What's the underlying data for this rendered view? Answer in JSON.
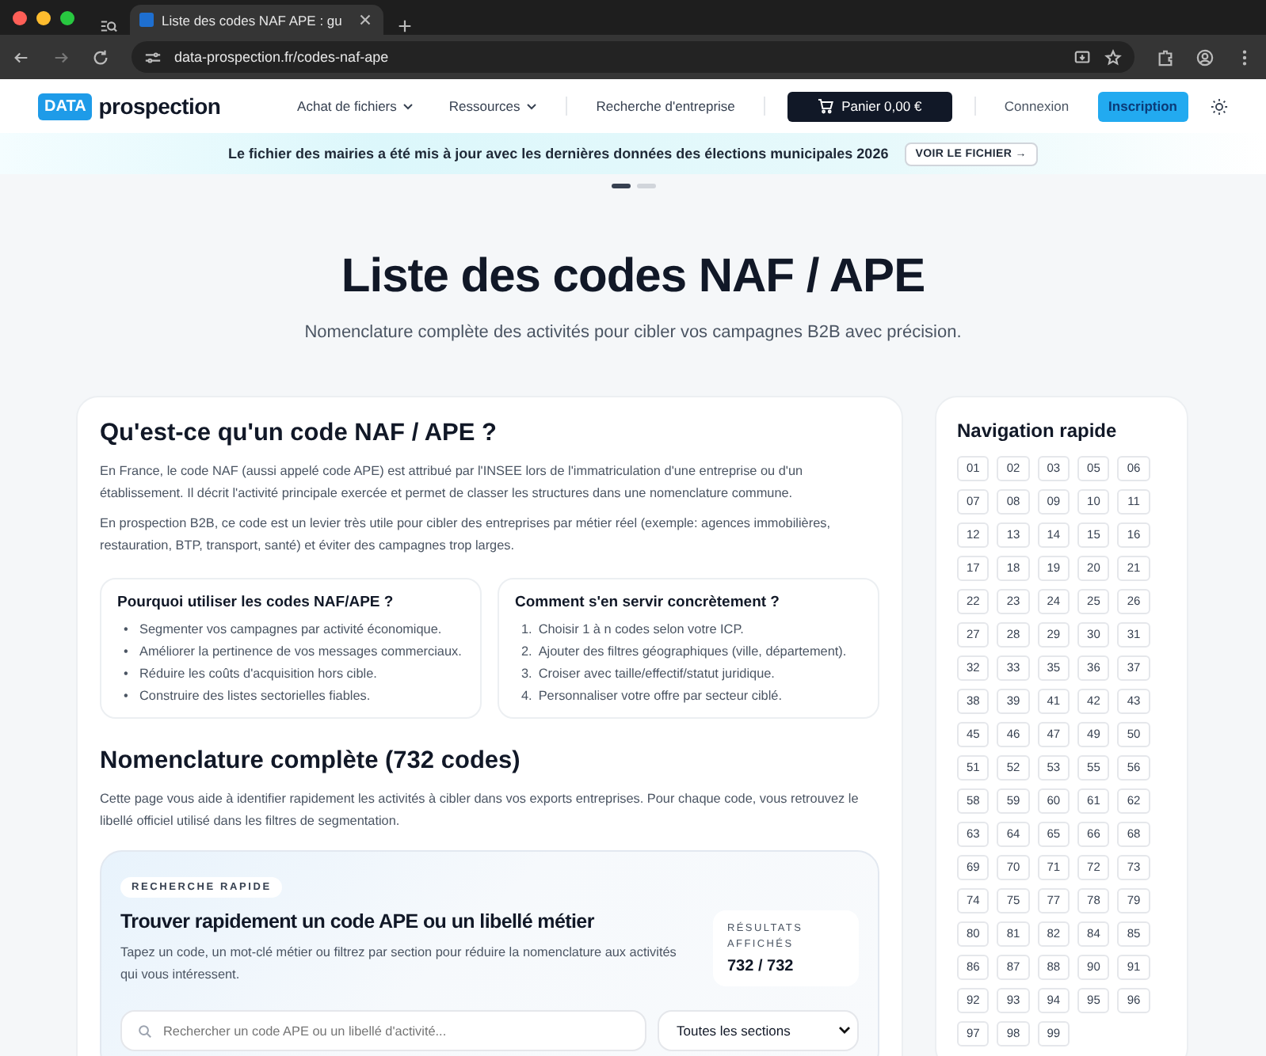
{
  "browser": {
    "tab_title": "Liste des codes NAF APE : gu",
    "url": "data-prospection.fr/codes-naf-ape"
  },
  "header": {
    "logo_badge": "DATA",
    "logo_text": "prospection",
    "nav": [
      {
        "label": "Achat de fichiers",
        "dropdown": true
      },
      {
        "label": "Ressources",
        "dropdown": true
      },
      {
        "label": "Recherche d'entreprise",
        "dropdown": false
      }
    ],
    "cart": "Panier 0,00 €",
    "login": "Connexion",
    "signup": "Inscription"
  },
  "banner": {
    "text": "Le fichier des mairies a été mis à jour avec les dernières données des élections municipales 2026",
    "button": "VOIR LE FICHIER →"
  },
  "carousel_dots": [
    {
      "selected": true
    },
    {
      "selected": false
    }
  ],
  "hero": {
    "title": "Liste des codes NAF / APE",
    "subtitle": "Nomenclature complète des activités pour cibler vos campagnes B2B avec précision."
  },
  "intro": {
    "title": "Qu'est-ce qu'un code NAF / APE ?",
    "paragraphs": [
      "En France, le code NAF (aussi appelé code APE) est attribué par l'INSEE lors de l'immatriculation d'une entreprise ou d'un établissement. Il décrit l'activité principale exercée et permet de classer les structures dans une nomenclature commune.",
      "En prospection B2B, ce code est un levier très utile pour cibler des entreprises par métier réel (exemple: agences immobilières, restauration, BTP, transport, santé) et éviter des campagnes trop larges."
    ],
    "boxes": [
      {
        "title": "Pourquoi utiliser les codes NAF/APE ?",
        "items": [
          {
            "marker": "•",
            "text": "Segmenter vos campagnes par activité économique."
          },
          {
            "marker": "•",
            "text": "Améliorer la pertinence de vos messages commerciaux."
          },
          {
            "marker": "•",
            "text": "Réduire les coûts d'acquisition hors cible."
          },
          {
            "marker": "•",
            "text": "Construire des listes sectorielles fiables."
          }
        ]
      },
      {
        "title": "Comment s'en servir concrètement ?",
        "items": [
          {
            "marker": "1.",
            "text": "Choisir 1 à n codes selon votre ICP."
          },
          {
            "marker": "2.",
            "text": "Ajouter des filtres géographiques (ville, département)."
          },
          {
            "marker": "3.",
            "text": "Croiser avec taille/effectif/statut juridique."
          },
          {
            "marker": "4.",
            "text": "Personnaliser votre offre par secteur ciblé."
          }
        ]
      }
    ]
  },
  "nomenclature": {
    "title": "Nomenclature complète (732 codes)",
    "text": "Cette page vous aide à identifier rapidement les activités à cibler dans vos exports entreprises. Pour chaque code, vous retrouvez le libellé officiel utilisé dans les filtres de segmentation.",
    "search_panel": {
      "badge": "RECHERCHE RAPIDE",
      "title": "Trouver rapidement un code APE ou un libellé métier",
      "text": "Tapez un code, un mot-clé métier ou filtrez par section pour réduire la nomenclature aux activités qui vous intéressent.",
      "results_label": "RÉSULTATS AFFICHÉS",
      "results_value": "732 / 732",
      "search_placeholder": "Rechercher un code APE ou un libellé d'activité...",
      "section_select": "Toutes les sections"
    }
  },
  "quick_nav": {
    "title": "Navigation rapide",
    "codes": [
      "01",
      "02",
      "03",
      "05",
      "06",
      "07",
      "08",
      "09",
      "10",
      "11",
      "12",
      "13",
      "14",
      "15",
      "16",
      "17",
      "18",
      "19",
      "20",
      "21",
      "22",
      "23",
      "24",
      "25",
      "26",
      "27",
      "28",
      "29",
      "30",
      "31",
      "32",
      "33",
      "35",
      "36",
      "37",
      "38",
      "39",
      "41",
      "42",
      "43",
      "45",
      "46",
      "47",
      "49",
      "50",
      "51",
      "52",
      "53",
      "55",
      "56",
      "58",
      "59",
      "60",
      "61",
      "62",
      "63",
      "64",
      "65",
      "66",
      "68",
      "69",
      "70",
      "71",
      "72",
      "73",
      "74",
      "75",
      "77",
      "78",
      "79",
      "80",
      "81",
      "82",
      "84",
      "85",
      "86",
      "87",
      "88",
      "90",
      "91",
      "92",
      "93",
      "94",
      "95",
      "96",
      "97",
      "98",
      "99"
    ]
  }
}
